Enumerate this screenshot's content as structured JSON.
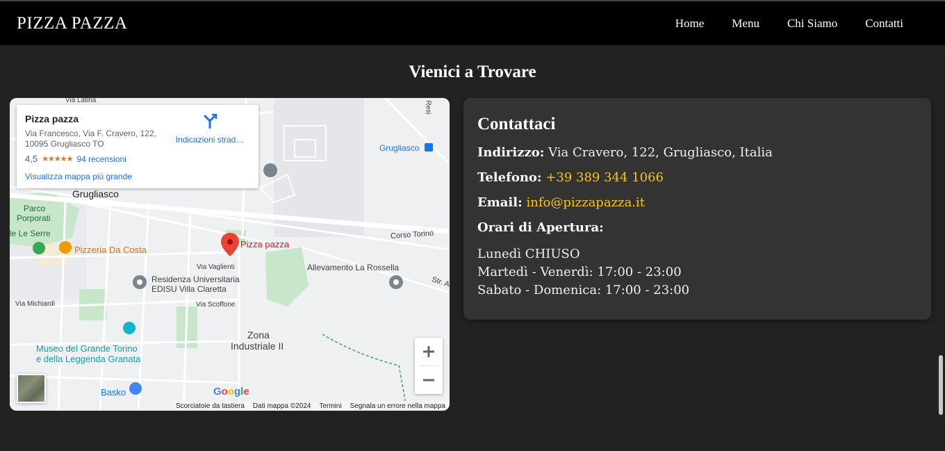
{
  "header": {
    "brand": "PIZZA PAZZA",
    "nav": [
      "Home",
      "Menu",
      "Chi Siamo",
      "Contatti"
    ]
  },
  "section": {
    "title": "Vienici a Trovare"
  },
  "map": {
    "place_card": {
      "name": "Pizza pazza",
      "address_line1": "Via Francesco, Via F. Cravero, 122,",
      "address_line2": "10095 Grugliasco TO",
      "rating": "4,5",
      "stars": "★★★★★",
      "reviews": "94 recensioni",
      "directions": "Indicazioni strad…",
      "larger_map": "Visualizza mappa più grande"
    },
    "labels": {
      "pin": "Pizza pazza",
      "city": "Grugliasco",
      "station": "Grugliasco",
      "parco": "Parco",
      "porporati": "Porporati",
      "le_serre": "le Le Serre",
      "pizzeria": "Pizzeria Da Costa",
      "corso": "Corso Torino",
      "via_vaglienti": "Via Vaglienti",
      "allevamento": "Allevamento La Rossella",
      "residenza1": "Residenza Universitaria",
      "residenza2": "EDISU Villa Claretta",
      "via_scoffone": "Via Scoffone",
      "via_michiardi": "Via Michiardi",
      "zona1": "Zona",
      "zona2": "Industriale II",
      "museo1": "Museo del Grande Torino",
      "museo2": "e della Leggenda Granata",
      "basko": "Basko",
      "str": "Str. A",
      "via_latina": "Via Latina",
      "resi": "Resi"
    },
    "google": "Google",
    "attribution": [
      "Scorciatoie da tastiera",
      "Dati mappa ©2024",
      "Termini",
      "Segnala un errore nella mappa"
    ],
    "zoom_in": "+",
    "zoom_out": "−"
  },
  "contact": {
    "title": "Contattaci",
    "address_label": "Indirizzo:",
    "address": "Via Cravero, 122, Grugliasco, Italia",
    "phone_label": "Telefono:",
    "phone": "+39 389 344 1066",
    "email_label": "Email:",
    "email": "info@pizzapazza.it",
    "hours_label": "Orari di Apertura:",
    "hours": [
      "Lunedì CHIUSO",
      "Martedì - Venerdì: 17:00 - 23:00",
      "Sabato - Domenica: 17:00 - 23:00"
    ]
  },
  "colors": {
    "background": "#222222",
    "header": "#000000",
    "card": "#333333",
    "link": "#f5c518"
  }
}
